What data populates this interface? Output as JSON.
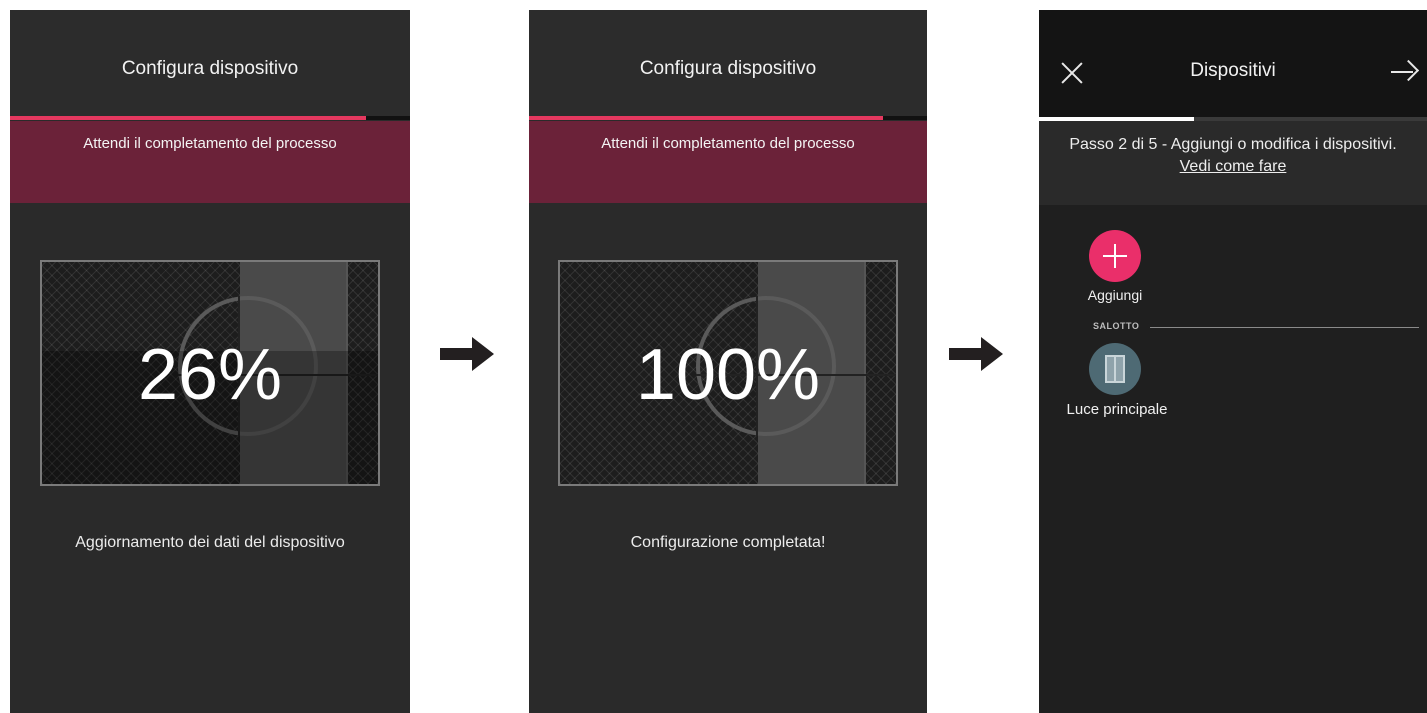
{
  "screen1": {
    "title": "Configura dispositivo",
    "banner": "Attendi il completamento del processo",
    "progress_percent": 26,
    "header_progress_fraction": 0.89,
    "percent_text": "26%",
    "caption": "Aggiornamento dei dati del dispositivo"
  },
  "screen2": {
    "title": "Configura dispositivo",
    "banner": "Attendi il completamento del processo",
    "progress_percent": 100,
    "header_progress_fraction": 0.89,
    "percent_text": "100%",
    "caption": "Configurazione completata!"
  },
  "screen3": {
    "title": "Dispositivi",
    "close_icon": "close-icon",
    "next_icon": "arrow-right-icon",
    "wizard_progress_fraction": 0.4,
    "step_text": "Passo 2 di 5 - Aggiungi o modifica i dispositivi.",
    "step_link": "Vedi come fare",
    "add_label": "Aggiungi",
    "room": "SALOTTO",
    "device_label": "Luce principale"
  },
  "colors": {
    "accent_pink": "#ea2f6a",
    "progress_red": "#e5385f",
    "banner_maroon": "#6b2239",
    "screen_bg": "#2a2a2a"
  }
}
